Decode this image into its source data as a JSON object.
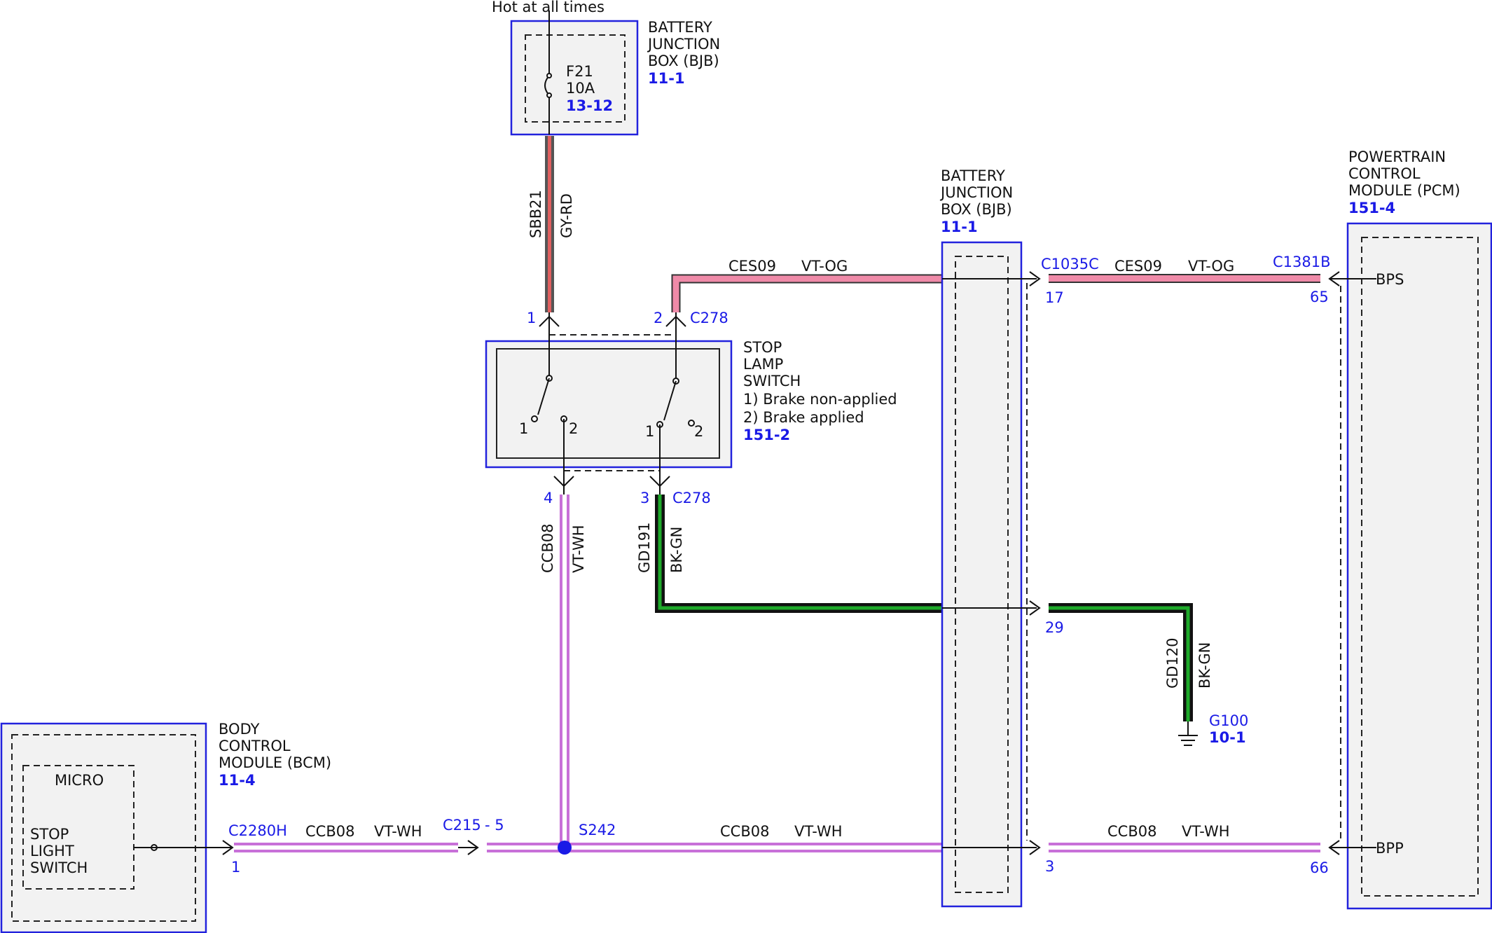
{
  "components": {
    "bjb_top": {
      "name": [
        "BATTERY",
        "JUNCTION",
        "BOX (BJB)"
      ],
      "ref": "11-1",
      "power_note": "Hot at all times",
      "fuse": {
        "id": "F21",
        "rating": "10A",
        "ref": "13-12"
      }
    },
    "bjb_mid": {
      "name": [
        "BATTERY",
        "JUNCTION",
        "BOX (BJB)"
      ],
      "ref": "11-1"
    },
    "pcm": {
      "name": [
        "POWERTRAIN",
        "CONTROL",
        "MODULE (PCM)"
      ],
      "ref": "151-4",
      "pin_bps": "BPS",
      "pin_bpp": "BPP"
    },
    "stop_switch": {
      "name": [
        "STOP",
        "LAMP",
        "SWITCH"
      ],
      "states": [
        "1) Brake non-applied",
        "2) Brake applied"
      ],
      "ref": "151-2",
      "contact_1": "1",
      "contact_2": "2"
    },
    "bcm": {
      "name": [
        "BODY",
        "CONTROL",
        "MODULE (BCM)"
      ],
      "ref": "11-4",
      "micro": "MICRO",
      "input": [
        "STOP",
        "LIGHT",
        "SWITCH"
      ]
    },
    "ground": {
      "id": "G100",
      "ref": "10-1"
    }
  },
  "connectors": {
    "c278": "C278",
    "c1035c": "C1035C",
    "c1381b": "C1381B",
    "c2280h": "C2280H",
    "c215": "C215",
    "s242": "S242"
  },
  "pins": {
    "sw_1": "1",
    "sw_2": "2",
    "sw_3": "3",
    "sw_4": "4",
    "bjb_17": "17",
    "bjb_29": "29",
    "bjb_3": "3",
    "pcm_65": "65",
    "pcm_66": "66",
    "bcm_1": "1",
    "c215_5": "- 5"
  },
  "wires": {
    "sbb21": {
      "circuit": "SBB21",
      "color": "GY-RD"
    },
    "ces09": {
      "circuit": "CES09",
      "color": "VT-OG"
    },
    "ccb08": {
      "circuit": "CCB08",
      "color": "VT-WH"
    },
    "gd191": {
      "circuit": "GD191",
      "color": "BK-GN"
    },
    "gd120": {
      "circuit": "GD120",
      "color": "BK-GN"
    }
  }
}
